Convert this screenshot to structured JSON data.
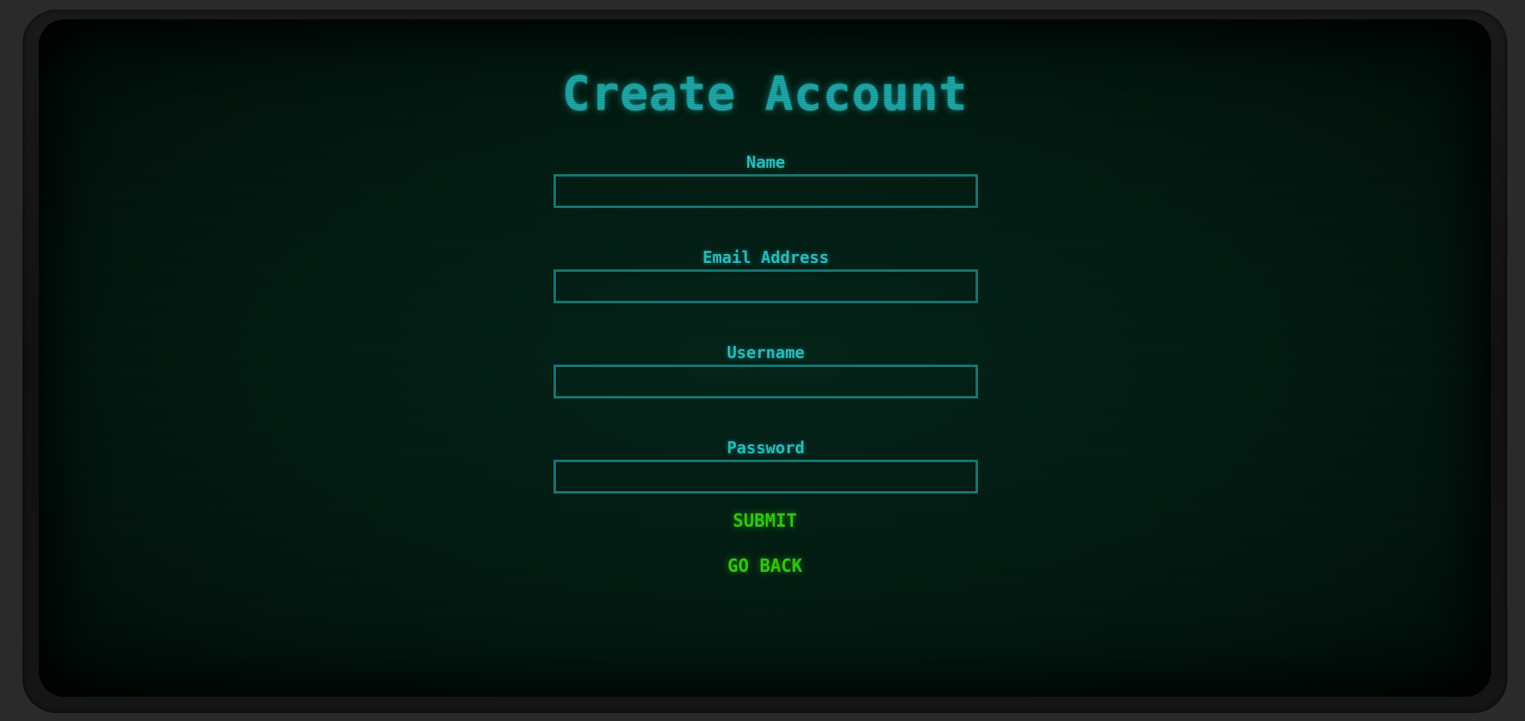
{
  "page": {
    "title": "Create Account"
  },
  "form": {
    "fields": [
      {
        "label": "Name",
        "value": "",
        "placeholder": ""
      },
      {
        "label": "Email Address",
        "value": "",
        "placeholder": ""
      },
      {
        "label": "Username",
        "value": "",
        "placeholder": ""
      },
      {
        "label": "Password",
        "value": "",
        "placeholder": ""
      }
    ],
    "submit_label": "SUBMIT",
    "back_label": "GO BACK"
  },
  "colors": {
    "title": "#1ea6a6",
    "label": "#2bc0c0",
    "input_border": "#157a78",
    "button": "#33cc11",
    "background": "#031d13"
  }
}
